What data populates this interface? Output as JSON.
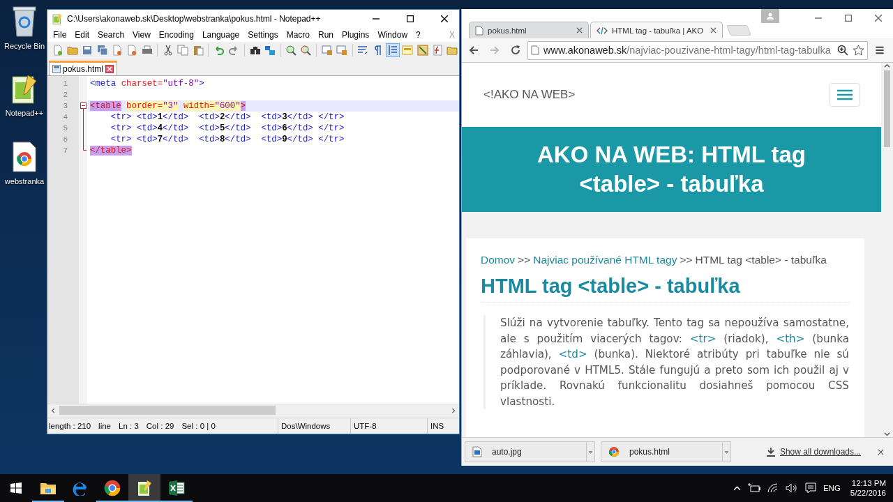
{
  "desktop_icons": [
    {
      "label": "Recycle Bin",
      "kind": "recycle"
    },
    {
      "label": "Notepad++",
      "kind": "notepad"
    },
    {
      "label": "webstranka",
      "kind": "chrome"
    }
  ],
  "notepad": {
    "title": "C:\\Users\\akonaweb.sk\\Desktop\\webstranka\\pokus.html - Notepad++",
    "menu": [
      "File",
      "Edit",
      "Search",
      "View",
      "Encoding",
      "Language",
      "Settings",
      "Macro",
      "Run",
      "Plugins",
      "Window",
      "?"
    ],
    "close_doc": "X",
    "tabs": [
      {
        "label": "pokus.html",
        "selected": true
      }
    ],
    "lines": [
      {
        "number": "1",
        "current": false,
        "kind": "plain",
        "tokens": [
          {
            "kind": "tag",
            "text": "<meta"
          },
          {
            "kind": "attr",
            "text": " charset="
          },
          {
            "kind": "value",
            "text": "\"utf-8\""
          },
          {
            "kind": "tag",
            "text": ">"
          }
        ]
      },
      {
        "number": "2",
        "current": false,
        "kind": "plain"
      },
      {
        "number": "3",
        "current": true,
        "kind": "fold_start",
        "tokens": [
          {
            "kind": "match",
            "text": "<table"
          },
          {
            "kind": "attr_hl",
            "text": " border="
          },
          {
            "kind": "value_hl",
            "text": "\"3\""
          },
          {
            "kind": "attr_hl",
            "text": " width="
          },
          {
            "kind": "value_hl",
            "text": "\"600\""
          },
          {
            "kind": "match",
            "text": ">"
          }
        ]
      },
      {
        "number": "4",
        "current": false,
        "kind": "fold_body",
        "tokens": [
          {
            "kind": "tag",
            "text": "    <tr> <td>"
          },
          {
            "kind": "text",
            "text": "1"
          },
          {
            "kind": "tag",
            "text": "</td>  <td>"
          },
          {
            "kind": "text",
            "text": "2"
          },
          {
            "kind": "tag",
            "text": "</td>  <td>"
          },
          {
            "kind": "text",
            "text": "3"
          },
          {
            "kind": "tag",
            "text": "</td> </tr>"
          }
        ]
      },
      {
        "number": "5",
        "current": false,
        "kind": "fold_body",
        "tokens": [
          {
            "kind": "tag",
            "text": "    <tr> <td>"
          },
          {
            "kind": "text",
            "text": "4"
          },
          {
            "kind": "tag",
            "text": "</td>  <td>"
          },
          {
            "kind": "text",
            "text": "5"
          },
          {
            "kind": "tag",
            "text": "</td>  <td>"
          },
          {
            "kind": "text",
            "text": "6"
          },
          {
            "kind": "tag",
            "text": "</td> </tr>"
          }
        ]
      },
      {
        "number": "6",
        "current": false,
        "kind": "fold_body",
        "tokens": [
          {
            "kind": "tag",
            "text": "    <tr> <td>"
          },
          {
            "kind": "text",
            "text": "7"
          },
          {
            "kind": "tag",
            "text": "</td>  <td>"
          },
          {
            "kind": "text",
            "text": "8"
          },
          {
            "kind": "tag",
            "text": "</td>  <td>"
          },
          {
            "kind": "text",
            "text": "9"
          },
          {
            "kind": "tag",
            "text": "</td> </tr>"
          }
        ]
      },
      {
        "number": "7",
        "current": false,
        "kind": "fold_end",
        "tokens": [
          {
            "kind": "match",
            "text": "</table>"
          }
        ]
      }
    ],
    "status_left": [
      "length : 210",
      "line",
      "Ln : 3",
      "Col : 29",
      "Sel : 0 | 0"
    ],
    "eol": "Dos\\Windows",
    "encoding": "UTF-8",
    "mode": "INS"
  },
  "browser": {
    "tabs": [
      {
        "label": "pokus.html",
        "selected": false,
        "kind": "page"
      },
      {
        "label": "HTML tag - tabuľka | AKO",
        "selected": true,
        "kind": "code"
      }
    ],
    "nav": [
      {
        "kind": "back",
        "disabled": false
      },
      {
        "kind": "forward",
        "disabled": true
      },
      {
        "kind": "reload",
        "disabled": false
      }
    ],
    "url_host": "www.akonaweb.sk",
    "url_path": "/najviac-pouzivane-html-tagy/html-tag-tabulka",
    "page": {
      "logo": "<!AKO NA WEB>",
      "banner_title": "AKO NA WEB: HTML tag <table> - tabuľka",
      "breadcrumb": [
        {
          "kind": "link",
          "text": "Domov"
        },
        {
          "kind": "sep",
          "text": ">>"
        },
        {
          "kind": "link",
          "text": "Najviac používané HTML tagy"
        },
        {
          "kind": "sep",
          "text": ">>"
        },
        {
          "kind": "current",
          "text": "HTML tag <table> - tabuľka"
        }
      ],
      "heading": "HTML tag <table> - tabuľka",
      "paragraph": [
        {
          "kind": "text",
          "text": "Slúži na vytvorenie tabuľky. Tento tag sa nepoužíva samostatne, ale s použitím viacerých tagov: "
        },
        {
          "kind": "code",
          "text": "<tr>"
        },
        {
          "kind": "text",
          "text": " (riadok), "
        },
        {
          "kind": "code",
          "text": "<th>"
        },
        {
          "kind": "text",
          "text": " (bunka záhlavia), "
        },
        {
          "kind": "code",
          "text": "<td>"
        },
        {
          "kind": "text",
          "text": " (bunka). Niektoré atribúty pri tabuľke nie sú podporované v HTML5. Stále fungujú a preto som ich použil aj v príklade. Rovnakú funkcionalitu dosiahneš pomocou CSS vlastnosti."
        }
      ]
    },
    "downloads": [
      {
        "name": "auto.jpg",
        "kind": "image"
      },
      {
        "name": "pokus.html",
        "kind": "chrome"
      }
    ],
    "show_all": "Show all downloads..."
  },
  "taskbar": {
    "apps": [
      {
        "kind": "explorer",
        "running": true,
        "selected": false
      },
      {
        "kind": "edge",
        "running": false,
        "selected": false
      },
      {
        "kind": "chrome",
        "running": true,
        "selected": false
      },
      {
        "kind": "notepad",
        "running": true,
        "selected": true
      },
      {
        "kind": "excel",
        "running": true,
        "selected": false
      }
    ],
    "language": "ENG",
    "time": "12:13 PM",
    "date": "5/22/2016"
  }
}
